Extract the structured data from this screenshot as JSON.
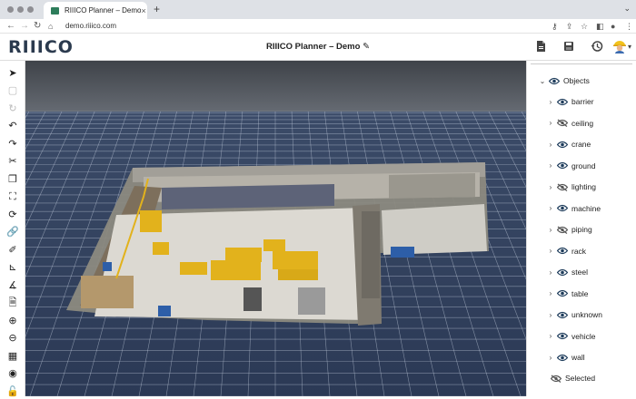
{
  "browser": {
    "tab_title": "RIIICO Planner – Demo",
    "tab_close": "×",
    "new_tab": "+",
    "tabs_menu": "⌄",
    "url": "demo.riiico.com"
  },
  "app": {
    "logo": "RIIICO",
    "project_title": "RIIICO Planner – Demo",
    "edit_glyph": "✎"
  },
  "tools": [
    {
      "name": "select-tool",
      "glyph": "➤"
    },
    {
      "name": "box-tool",
      "glyph": "▢"
    },
    {
      "name": "redo-disabled-tool",
      "glyph": "↻"
    },
    {
      "name": "undo-tool",
      "glyph": "↶"
    },
    {
      "name": "redo-tool",
      "glyph": "↷"
    },
    {
      "name": "cut-tool",
      "glyph": "✂"
    },
    {
      "name": "copy-tool",
      "glyph": "❐"
    },
    {
      "name": "crop-tool",
      "glyph": "⛶"
    },
    {
      "name": "rotate-tool",
      "glyph": "⟳"
    },
    {
      "name": "link-tool",
      "glyph": "🔗"
    },
    {
      "name": "paint-tool",
      "glyph": "✐"
    },
    {
      "name": "measure-tool",
      "glyph": "⊾"
    },
    {
      "name": "angle-tool",
      "glyph": "∡"
    },
    {
      "name": "report-tool",
      "glyph": "🗎"
    },
    {
      "name": "zoom-in-tool",
      "glyph": "⊕"
    },
    {
      "name": "zoom-out-tool",
      "glyph": "⊖"
    },
    {
      "name": "grid-tool",
      "glyph": "▦"
    },
    {
      "name": "camera-tool",
      "glyph": "◉"
    },
    {
      "name": "lock-tool",
      "glyph": "🔓"
    }
  ],
  "objects_panel": {
    "root_label": "Objects",
    "items": [
      {
        "label": "barrier",
        "visible": true
      },
      {
        "label": "ceiling",
        "visible": false
      },
      {
        "label": "crane",
        "visible": true
      },
      {
        "label": "ground",
        "visible": true
      },
      {
        "label": "lighting",
        "visible": false
      },
      {
        "label": "machine",
        "visible": true
      },
      {
        "label": "piping",
        "visible": false
      },
      {
        "label": "rack",
        "visible": true
      },
      {
        "label": "steel",
        "visible": true
      },
      {
        "label": "table",
        "visible": true
      },
      {
        "label": "unknown",
        "visible": true
      },
      {
        "label": "vehicle",
        "visible": true
      },
      {
        "label": "wall",
        "visible": true
      }
    ],
    "selected_label": "Selected"
  },
  "colors": {
    "eye": "#1f3d5c",
    "eye_off": "#555555",
    "machine_yellow": "#e2b21c",
    "grid_line": "#c6d0e0"
  }
}
